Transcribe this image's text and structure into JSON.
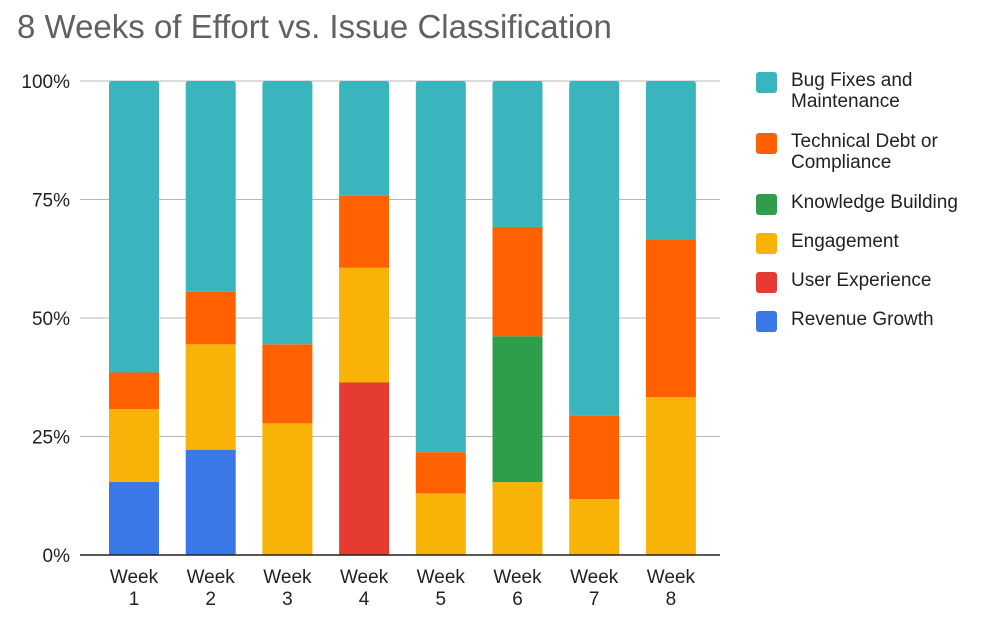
{
  "chart_data": {
    "type": "bar",
    "stacked": "percent",
    "title": "8 Weeks of Effort vs. Issue Classification",
    "xlabel": "",
    "ylabel": "",
    "ylim": [
      0,
      100
    ],
    "yticks": [
      "0%",
      "25%",
      "50%",
      "75%",
      "100%"
    ],
    "grid": true,
    "legend_position": "right",
    "categories": [
      [
        "Week",
        "1"
      ],
      [
        "Week",
        "2"
      ],
      [
        "Week",
        "3"
      ],
      [
        "Week",
        "4"
      ],
      [
        "Week",
        "5"
      ],
      [
        "Week",
        "6"
      ],
      [
        "Week",
        "7"
      ],
      [
        "Week",
        "8"
      ]
    ],
    "series": [
      {
        "name": "Revenue Growth",
        "color": "#3b78e7",
        "values": [
          15.4,
          22.2,
          0,
          0,
          0,
          0,
          0,
          0
        ]
      },
      {
        "name": "User Experience",
        "color": "#e53b30",
        "values": [
          0,
          0,
          0,
          36.4,
          0,
          0,
          0,
          0
        ]
      },
      {
        "name": "Engagement",
        "color": "#f9b208",
        "values": [
          15.4,
          22.2,
          27.8,
          24.2,
          13.0,
          15.4,
          11.8,
          33.3
        ]
      },
      {
        "name": "Knowledge Building",
        "color": "#2e9e4a",
        "values": [
          0,
          0,
          0,
          0,
          0,
          30.8,
          0,
          0
        ]
      },
      {
        "name": "Technical Debt or Compliance",
        "color": "#ff6000",
        "values": [
          7.7,
          11.1,
          16.7,
          15.2,
          8.7,
          23.1,
          17.6,
          33.3
        ]
      },
      {
        "name": "Bug Fixes and Maintenance",
        "color": "#3ab4bd",
        "values": [
          61.5,
          44.4,
          55.6,
          24.2,
          78.3,
          30.8,
          70.6,
          33.4
        ]
      }
    ],
    "legend_order": [
      [
        "Bug Fixes and",
        "Maintenance"
      ],
      [
        "Technical Debt or",
        "Compliance"
      ],
      [
        "Knowledge Building"
      ],
      [
        "Engagement"
      ],
      [
        "User Experience"
      ],
      [
        "Revenue Growth"
      ]
    ],
    "legend_colors": [
      "#3ab4bd",
      "#ff6000",
      "#2e9e4a",
      "#f9b208",
      "#e53b30",
      "#3b78e7"
    ]
  }
}
